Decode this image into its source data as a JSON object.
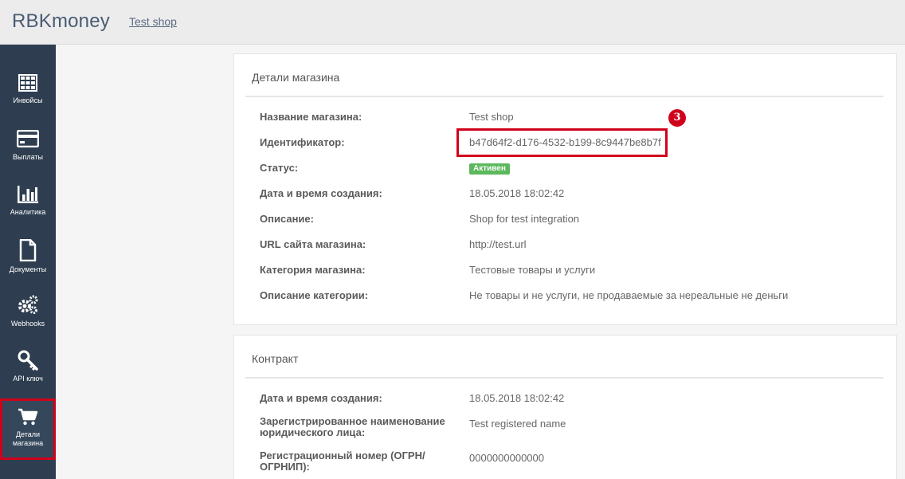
{
  "header": {
    "brand": "RBKmoney",
    "shop_link": "Test shop"
  },
  "sidebar": {
    "items": [
      {
        "label": "Инвойсы",
        "icon": "invoices-grid-icon"
      },
      {
        "label": "Выплаты",
        "icon": "payouts-card-icon"
      },
      {
        "label": "Аналитика",
        "icon": "analytics-bar-chart-icon"
      },
      {
        "label": "Документы",
        "icon": "documents-file-icon"
      },
      {
        "label": "Webhooks",
        "icon": "webhooks-gears-icon"
      },
      {
        "label": "API ключ",
        "icon": "api-key-icon"
      },
      {
        "label_line1": "Детали",
        "label_line2": "магазина",
        "icon": "shop-cart-icon",
        "active": true
      }
    ]
  },
  "shop_details": {
    "title": "Детали магазина",
    "rows": [
      {
        "label": "Название магазина:",
        "value": "Test shop"
      },
      {
        "label": "Идентификатор:",
        "value": "b47d64f2-d176-4532-b199-8c9447be8b7f"
      },
      {
        "label": "Статус:",
        "value": "Активен"
      },
      {
        "label": "Дата и время создания:",
        "value": "18.05.2018 18:02:42"
      },
      {
        "label": "Описание:",
        "value": "Shop for test integration"
      },
      {
        "label": "URL сайта магазина:",
        "value": "http://test.url"
      },
      {
        "label": "Категория магазина:",
        "value": "Тестовые товары и услуги"
      },
      {
        "label": "Описание категории:",
        "value": "Не товары и не услуги, не продаваемые за нереальные не деньги"
      }
    ],
    "callout_number": "3"
  },
  "contract": {
    "title": "Контракт",
    "rows": [
      {
        "label": "Дата и время создания:",
        "value": "18.05.2018 18:02:42"
      },
      {
        "label_line1": "Зарегистрированное наименование",
        "label_line2": "юридического лица:",
        "value": "Test registered name"
      },
      {
        "label_line1": "Регистрационный номер (ОГРН/",
        "label_line2": "ОГРНИП):",
        "value": "0000000000000"
      }
    ]
  },
  "colors": {
    "sidebar_bg": "#2e3e50",
    "highlight_red": "#d0021b",
    "status_green": "#5cb85c",
    "brand_text": "#4a5c73"
  }
}
